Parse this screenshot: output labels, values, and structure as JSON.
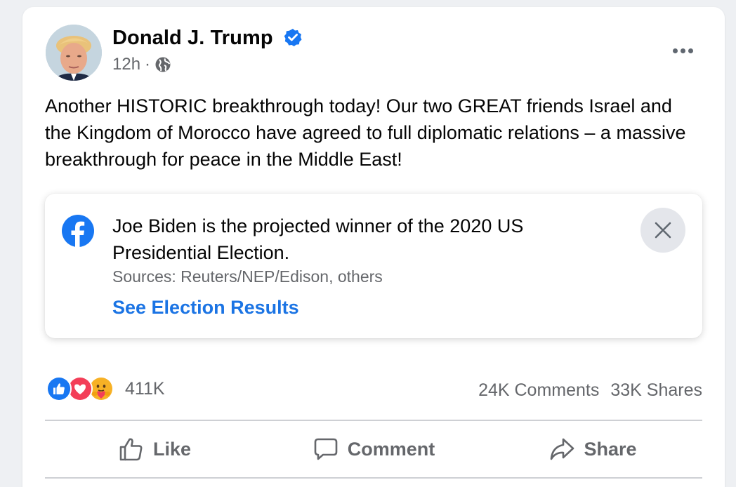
{
  "post": {
    "author": "Donald J. Trump",
    "verified_icon": "verified-badge-icon",
    "time": "12h",
    "separator": "·",
    "audience_icon": "globe-icon",
    "more_icon": "more-options-icon",
    "text": "Another HISTORIC breakthrough today! Our two GREAT friends Israel and the Kingdom of Morocco have agreed to full diplomatic relations – a massive breakthrough for peace in the Middle East!"
  },
  "notice": {
    "logo_icon": "facebook-logo-icon",
    "title": "Joe Biden is the projected winner of the 2020 US Presidential Election.",
    "sources": "Sources: Reuters/NEP/Edison, others",
    "link": "See Election Results",
    "close_icon": "close-icon"
  },
  "reactions": {
    "icons": [
      "like-reaction-icon",
      "love-reaction-icon",
      "care-reaction-icon"
    ],
    "count": "411K"
  },
  "engagement": {
    "comments": "24K Comments",
    "shares": "33K Shares"
  },
  "actions": {
    "like": "Like",
    "comment": "Comment",
    "share": "Share"
  },
  "colors": {
    "verified": "#1877f2",
    "link": "#1b74e4",
    "muted": "#65676b",
    "like_blue": "#1877f2",
    "love_red": "#f33e58",
    "care_yellow": "#f7b125"
  }
}
